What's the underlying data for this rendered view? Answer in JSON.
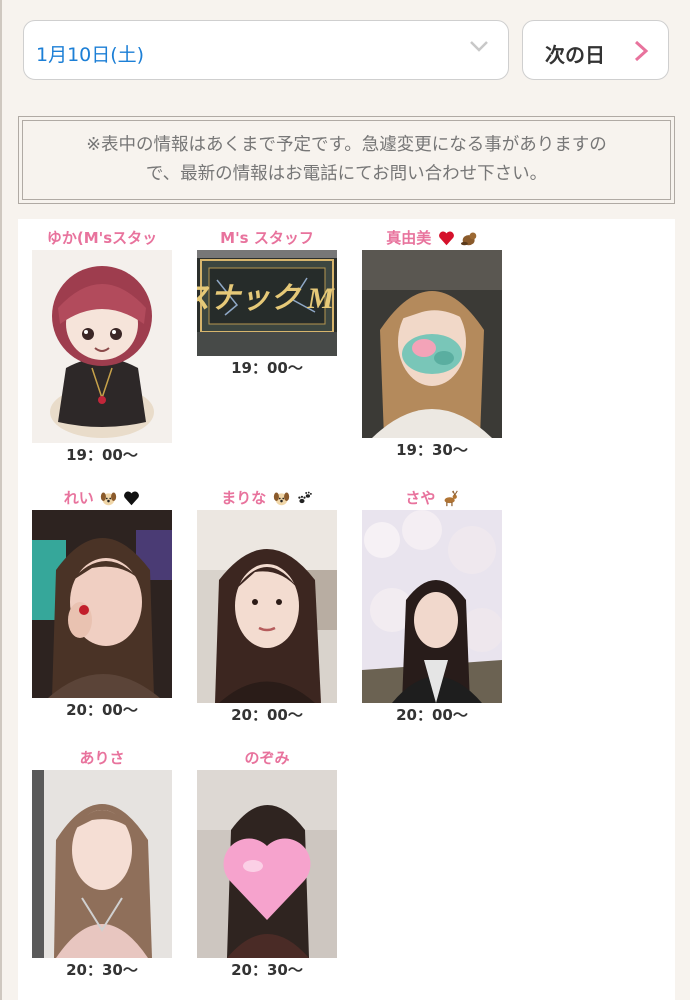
{
  "header": {
    "date_value": "1月10日(土)",
    "next_label": "次の日"
  },
  "notice": {
    "line1": "※表中の情報はあくまで予定です。急遽変更になる事がありますの",
    "line2": "で、最新の情報はお電話にてお問い合わせ下さい。"
  },
  "casts": [
    {
      "name": "ゆか(M'sスタッ",
      "time": "19：00〜",
      "icons": []
    },
    {
      "name": "M's スタッフ",
      "time": "19：00〜",
      "icons": []
    },
    {
      "name": "真由美",
      "time": "19：30〜",
      "icons": [
        "red-heart-icon",
        "beaver-icon"
      ]
    },
    {
      "name": "れい",
      "time": "20：00〜",
      "icons": [
        "dog-face-icon",
        "black-heart-icon"
      ]
    },
    {
      "name": "まりな",
      "time": "20：00〜",
      "icons": [
        "dog-face-icon",
        "paw-prints-icon"
      ]
    },
    {
      "name": "さや",
      "time": "20：00〜",
      "icons": [
        "deer-icon"
      ]
    },
    {
      "name": "ありさ",
      "time": "20：30〜",
      "icons": []
    },
    {
      "name": "のぞみ",
      "time": "20：30〜",
      "icons": []
    }
  ],
  "colors": {
    "accent_pink": "#e8739d",
    "date_blue": "#1c7fd6",
    "background": "#f7f3ee"
  },
  "sign_text": "スナック M's"
}
